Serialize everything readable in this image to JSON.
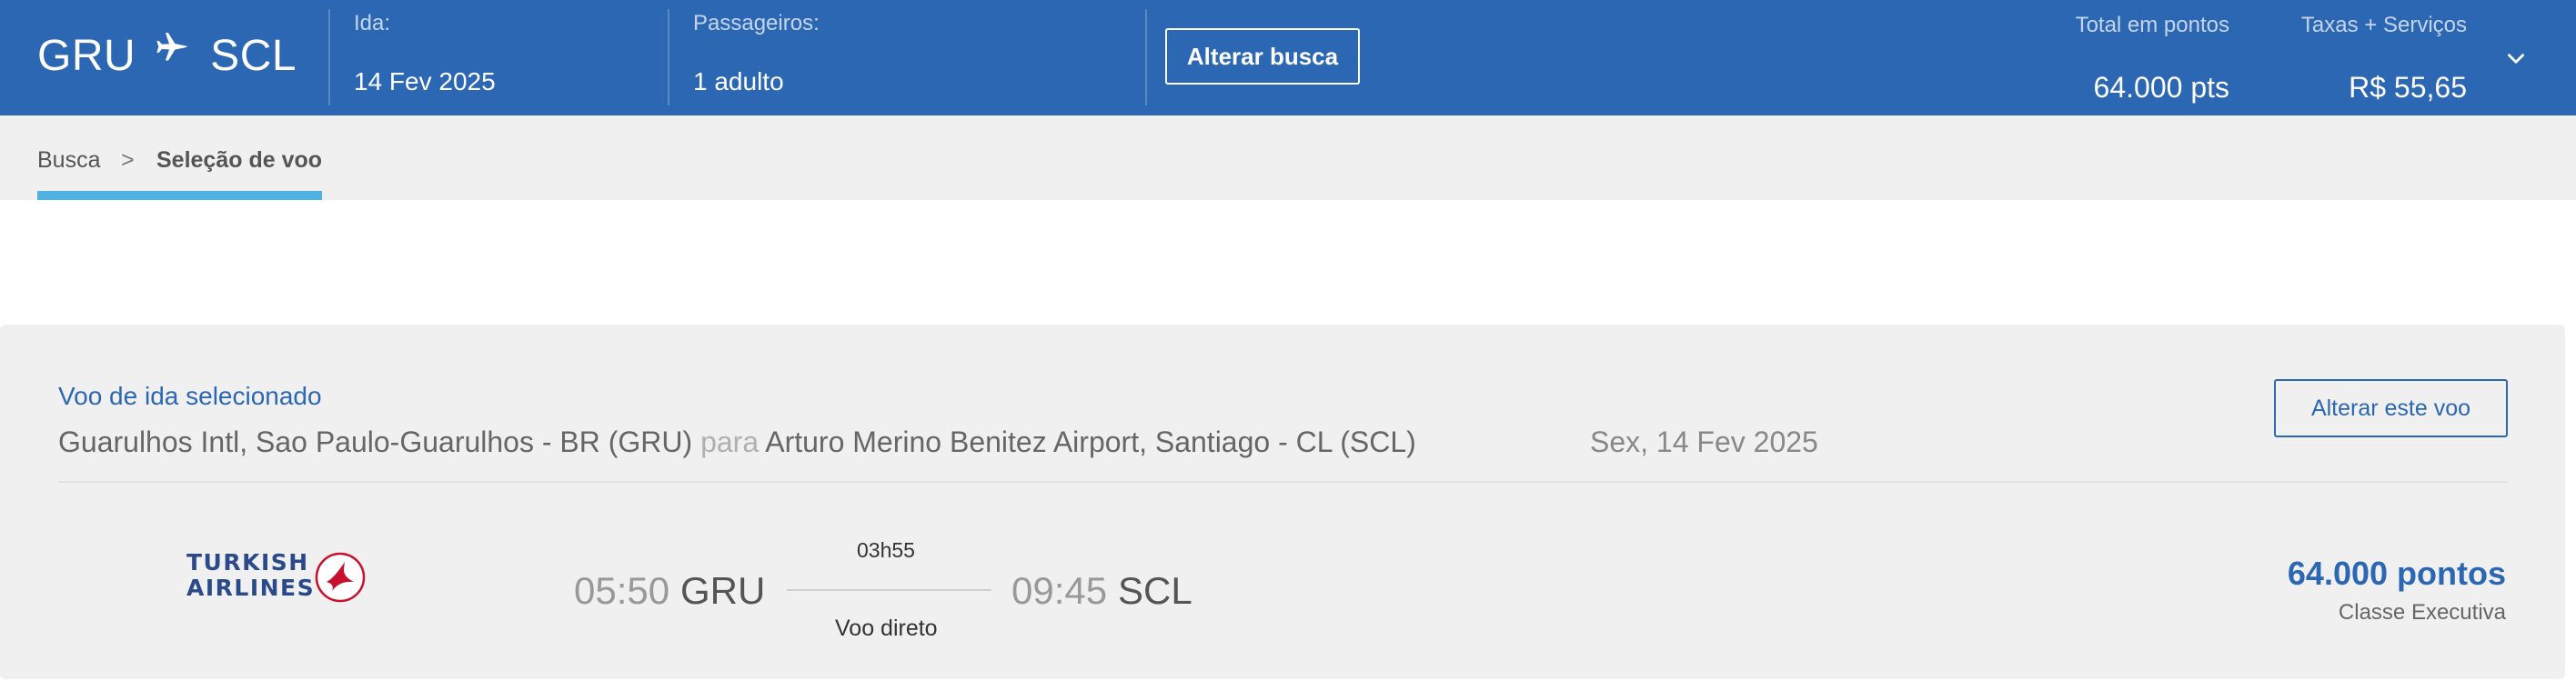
{
  "header": {
    "origin": "GRU",
    "destination": "SCL",
    "plane_icon": "plane-icon",
    "departure_label": "Ida:",
    "departure_value": "14 Fev 2025",
    "passengers_label": "Passageiros:",
    "passengers_value": "1 adulto",
    "change_search_label": "Alterar busca",
    "total_points_label": "Total em pontos",
    "total_points_value": "64.000 pts",
    "taxes_label": "Taxas + Serviços",
    "taxes_value": "R$ 55,65",
    "expand_icon": "chevron-down-icon"
  },
  "breadcrumb": {
    "items": [
      "Busca",
      "Seleção de voo"
    ],
    "separator": ">"
  },
  "selected_flight": {
    "title": "Voo de ida selecionado",
    "from": "Guarulhos Intl, Sao Paulo-Guarulhos - BR (GRU)",
    "connector": "para",
    "to": "Arturo Merino Benitez Airport, Santiago - CL (SCL)",
    "date": "Sex, 14 Fev 2025",
    "change_label": "Alterar este voo",
    "airline": {
      "name_line1": "TURKISH",
      "name_line2": "AIRLINES"
    },
    "departure_time": "05:50",
    "departure_code": "GRU",
    "duration": "03h55",
    "stops": "Voo direto",
    "arrival_time": "09:45",
    "arrival_code": "SCL",
    "points": "64.000 pontos",
    "cabin": "Classe Executiva"
  },
  "colors": {
    "brand_blue": "#2c67b3",
    "accent_cyan": "#4fb2e2",
    "panel_gray": "#f0f0f0",
    "airline_red": "#c8102e"
  }
}
